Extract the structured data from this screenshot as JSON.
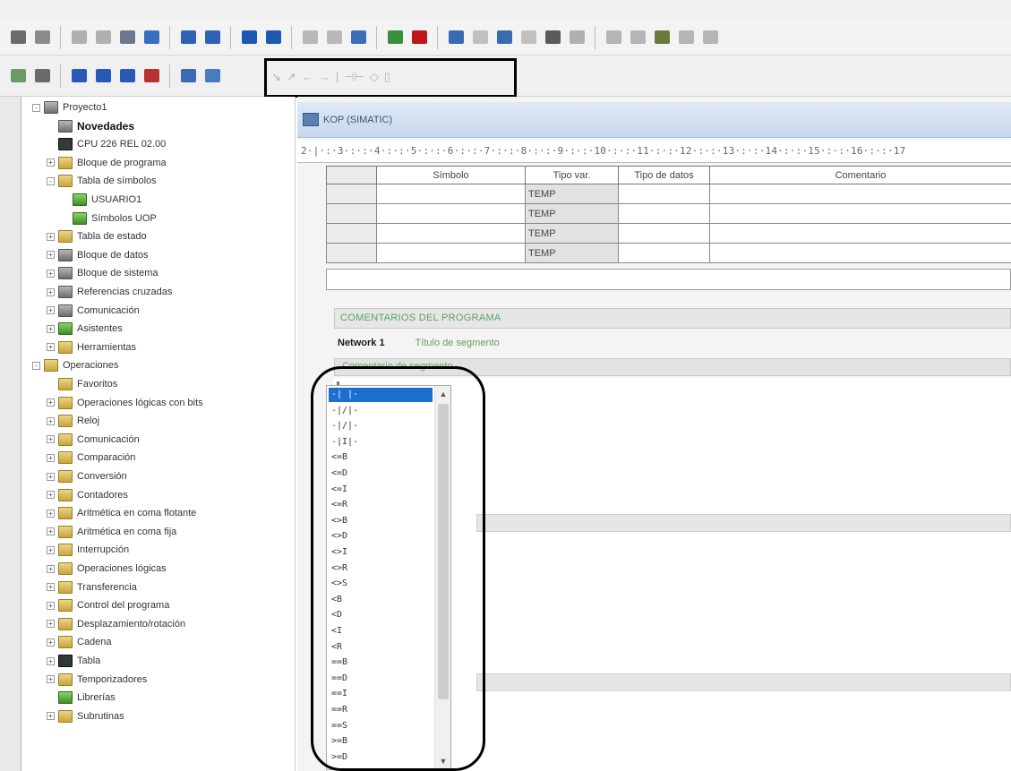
{
  "menubar": [],
  "toolbar1": {
    "buttons": [
      {
        "icon": "print-icon",
        "color": "#6b6b6b"
      },
      {
        "icon": "print-preview-icon",
        "color": "#8c8c8c"
      },
      {
        "sep": true
      },
      {
        "icon": "cut-icon",
        "color": "#b0b0b0"
      },
      {
        "icon": "copy-icon",
        "color": "#b0b0b0"
      },
      {
        "icon": "paste-icon",
        "color": "#6a7a8a"
      },
      {
        "icon": "undo-icon",
        "color": "#3a6fc0"
      },
      {
        "sep": true
      },
      {
        "icon": "compile-icon",
        "color": "#2f62b5"
      },
      {
        "icon": "compile-all-icon",
        "color": "#2f62b5"
      },
      {
        "sep": true
      },
      {
        "icon": "upload-icon",
        "color": "#1f58b0"
      },
      {
        "icon": "download-icon",
        "color": "#1f58b0"
      },
      {
        "sep": true
      },
      {
        "icon": "sort-ascending-icon",
        "color": "#b8b8b8"
      },
      {
        "icon": "sort-descending-icon",
        "color": "#b8b8b8"
      },
      {
        "icon": "options-icon",
        "color": "#3a70b5"
      },
      {
        "sep": true
      },
      {
        "icon": "run-icon",
        "color": "#3a8f3a"
      },
      {
        "icon": "stop-icon",
        "color": "#c01818"
      },
      {
        "sep": true
      },
      {
        "icon": "program-status-icon",
        "color": "#3a6ab0"
      },
      {
        "icon": "pause-status-icon",
        "color": "#c0c0c0"
      },
      {
        "icon": "status-chart-icon",
        "color": "#3a6ab0"
      },
      {
        "icon": "pause-chart-icon",
        "color": "#c0c0c0"
      },
      {
        "icon": "read-icon",
        "color": "#5a5a5a"
      },
      {
        "icon": "trend-icon",
        "color": "#b0b0b0"
      },
      {
        "sep": true
      },
      {
        "icon": "force-icon",
        "color": "#b5b5b5"
      },
      {
        "icon": "unforce-icon",
        "color": "#b5b5b5"
      },
      {
        "icon": "unforce-all-icon",
        "color": "#6a7a3a"
      },
      {
        "icon": "read-all-forced-icon",
        "color": "#b5b5b5"
      },
      {
        "icon": "single-read-icon",
        "color": "#b5b5b5"
      }
    ]
  },
  "toolbar2": {
    "buttons": [
      {
        "icon": "io-view-icon",
        "color": "#6a9a6a"
      },
      {
        "icon": "memory-icon",
        "color": "#6a6a6a"
      },
      {
        "sep": true
      },
      {
        "icon": "network-insert-icon",
        "color": "#2858b8"
      },
      {
        "icon": "network-line-down-icon",
        "color": "#2858b8"
      },
      {
        "icon": "network-line-up-icon",
        "color": "#2858b8"
      },
      {
        "icon": "network-delete-icon",
        "color": "#b83030"
      },
      {
        "sep": true
      },
      {
        "icon": "symbol-table-icon",
        "color": "#3a6ab0"
      },
      {
        "icon": "addressing-icon",
        "color": "#4a7ac0"
      }
    ],
    "dim_glyphs": [
      "↘",
      "↗",
      "←",
      "→",
      "|",
      "⊣⊢",
      "◇",
      "▯"
    ]
  },
  "tree": [
    {
      "label": "Proyecto1",
      "level": 0,
      "exp": "-",
      "icon": "project-icon",
      "color": "gray"
    },
    {
      "label": "Novedades",
      "level": 1,
      "exp": "",
      "icon": "news-icon",
      "color": "gray",
      "bold": true
    },
    {
      "label": "CPU 226 REL 02.00",
      "level": 1,
      "exp": "",
      "icon": "cpu-icon",
      "color": "cpu"
    },
    {
      "label": "Bloque de programa",
      "level": 1,
      "exp": "+",
      "icon": "program-block-icon",
      "color": "folder"
    },
    {
      "label": "Tabla de símbolos",
      "level": 1,
      "exp": "-",
      "icon": "symbol-table-icon",
      "color": "folder"
    },
    {
      "label": "USUARIO1",
      "level": 2,
      "exp": "",
      "icon": "symbol-sheet-icon",
      "color": "green"
    },
    {
      "label": "Símbolos UOP",
      "level": 2,
      "exp": "",
      "icon": "symbol-sheet-icon",
      "color": "green"
    },
    {
      "label": "Tabla de estado",
      "level": 1,
      "exp": "+",
      "icon": "status-table-icon",
      "color": "folder"
    },
    {
      "label": "Bloque de datos",
      "level": 1,
      "exp": "+",
      "icon": "data-block-icon",
      "color": "gray"
    },
    {
      "label": "Bloque de sistema",
      "level": 1,
      "exp": "+",
      "icon": "system-block-icon",
      "color": "gray"
    },
    {
      "label": "Referencias cruzadas",
      "level": 1,
      "exp": "+",
      "icon": "cross-reference-icon",
      "color": "gray"
    },
    {
      "label": "Comunicación",
      "level": 1,
      "exp": "+",
      "icon": "communication-icon",
      "color": "gray"
    },
    {
      "label": "Asistentes",
      "level": 1,
      "exp": "+",
      "icon": "wizard-icon",
      "color": "green"
    },
    {
      "label": "Herramientas",
      "level": 1,
      "exp": "+",
      "icon": "tools-icon",
      "color": "folder"
    },
    {
      "label": "Operaciones",
      "level": 0,
      "exp": "-",
      "icon": "instructions-icon",
      "color": "folder"
    },
    {
      "label": "Favoritos",
      "level": 1,
      "exp": "",
      "icon": "folder-icon",
      "color": "folder"
    },
    {
      "label": "Operaciones lógicas con bits",
      "level": 1,
      "exp": "+",
      "icon": "folder-icon",
      "color": "folder"
    },
    {
      "label": "Reloj",
      "level": 1,
      "exp": "+",
      "icon": "folder-icon",
      "color": "folder"
    },
    {
      "label": "Comunicación",
      "level": 1,
      "exp": "+",
      "icon": "folder-icon",
      "color": "folder"
    },
    {
      "label": "Comparación",
      "level": 1,
      "exp": "+",
      "icon": "folder-icon",
      "color": "folder"
    },
    {
      "label": "Conversión",
      "level": 1,
      "exp": "+",
      "icon": "folder-icon",
      "color": "folder"
    },
    {
      "label": "Contadores",
      "level": 1,
      "exp": "+",
      "icon": "folder-icon",
      "color": "folder"
    },
    {
      "label": "Aritmética en coma flotante",
      "level": 1,
      "exp": "+",
      "icon": "folder-icon",
      "color": "folder"
    },
    {
      "label": "Aritmética en coma fija",
      "level": 1,
      "exp": "+",
      "icon": "folder-icon",
      "color": "folder"
    },
    {
      "label": "Interrupción",
      "level": 1,
      "exp": "+",
      "icon": "folder-icon",
      "color": "folder"
    },
    {
      "label": "Operaciones lógicas",
      "level": 1,
      "exp": "+",
      "icon": "folder-icon",
      "color": "folder"
    },
    {
      "label": "Transferencia",
      "level": 1,
      "exp": "+",
      "icon": "folder-icon",
      "color": "folder"
    },
    {
      "label": "Control del programa",
      "level": 1,
      "exp": "+",
      "icon": "folder-icon",
      "color": "folder"
    },
    {
      "label": "Desplazamiento/rotación",
      "level": 1,
      "exp": "+",
      "icon": "folder-icon",
      "color": "folder"
    },
    {
      "label": "Cadena",
      "level": 1,
      "exp": "+",
      "icon": "folder-icon",
      "color": "folder"
    },
    {
      "label": "Tabla",
      "level": 1,
      "exp": "+",
      "icon": "folder-icon",
      "color": "cpu"
    },
    {
      "label": "Temporizadores",
      "level": 1,
      "exp": "+",
      "icon": "folder-icon",
      "color": "folder"
    },
    {
      "label": "Librerías",
      "level": 1,
      "exp": "",
      "icon": "library-icon",
      "color": "green"
    },
    {
      "label": "Subrutinas",
      "level": 1,
      "exp": "+",
      "icon": "folder-icon",
      "color": "folder"
    }
  ],
  "editor": {
    "title": "KOP (SIMATIC)",
    "ruler": "2·|·:·3·:·:·4·:·:·5·:·:·6·:·:·7·:·:·8·:·:·9·:·:·10·:·:·11·:·:·12·:·:·13·:·:·14·:·:·15·:·:·16·:·:·17",
    "var_table": {
      "headers": [
        "Símbolo",
        "Tipo var.",
        "Tipo de datos",
        "Comentario"
      ],
      "rows": [
        [
          "",
          "TEMP",
          "",
          ""
        ],
        [
          "",
          "TEMP",
          "",
          ""
        ],
        [
          "",
          "TEMP",
          "",
          ""
        ],
        [
          "",
          "TEMP",
          "",
          ""
        ]
      ]
    },
    "program_comment": "COMENTARIOS DEL PROGRAMA",
    "network_label": "Network 1",
    "network_title": "Título de segmento",
    "segment_comment": "Comentario de segmento"
  },
  "dropdown": {
    "items": [
      "-| |-",
      "-|/|-",
      "-|/|-",
      "-|I|-",
      "<=B",
      "<=D",
      "<=I",
      "<=R",
      "<>B",
      "<>D",
      "<>I",
      "<>R",
      "<>S",
      "<B",
      "<D",
      "<I",
      "<R",
      "==B",
      "==D",
      "==I",
      "==R",
      "==S",
      ">=B",
      ">=D"
    ],
    "selected": 0
  }
}
